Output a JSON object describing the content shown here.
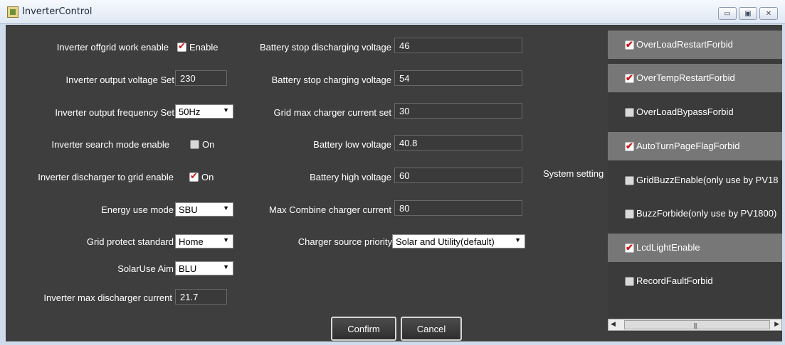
{
  "window": {
    "title": "InverterControl",
    "controls": [
      "▭",
      "▣",
      "✕"
    ]
  },
  "left": {
    "offgrid": {
      "label": "Inverter offgrid work enable",
      "checkbox_text": "Enable",
      "checked": true
    },
    "output_voltage": {
      "label": "Inverter output voltage Set",
      "value": "230"
    },
    "output_frequency": {
      "label": "Inverter output frequency Set",
      "value": "50Hz"
    },
    "search_mode": {
      "label": "Inverter search mode enable",
      "checkbox_text": "On",
      "checked": false
    },
    "discharger_grid": {
      "label": "Inverter discharger to grid enable",
      "checkbox_text": "On",
      "checked": true
    },
    "energy_mode": {
      "label": "Energy use mode",
      "value": "SBU"
    },
    "grid_standard": {
      "label": "Grid protect standard",
      "value": "Home"
    },
    "solar_aim": {
      "label": "SolarUse Aim",
      "value": "BLU"
    },
    "max_discharger": {
      "label": "Inverter max discharger current",
      "value": "21.7"
    }
  },
  "middle": {
    "stop_discharging": {
      "label": "Battery stop discharging voltage",
      "value": "46"
    },
    "stop_charging": {
      "label": "Battery stop charging voltage",
      "value": "54"
    },
    "grid_max_charger": {
      "label": "Grid max charger current set",
      "value": "30"
    },
    "battery_low": {
      "label": "Battery low voltage",
      "value": "40.8"
    },
    "battery_high": {
      "label": "Battery high voltage",
      "value": "60"
    },
    "max_combine": {
      "label": "Max Combine charger current",
      "value": "80"
    },
    "charger_priority": {
      "label": "Charger source priority",
      "value": "Solar and Utility(default)"
    }
  },
  "system_setting_label": "System setting",
  "system_settings": [
    {
      "label": "OverLoadRestartForbid",
      "checked": true
    },
    {
      "label": "OverTempRestartForbid",
      "checked": true
    },
    {
      "label": "OverLoadBypassForbid",
      "checked": false
    },
    {
      "label": "AutoTurnPageFlagForbid",
      "checked": true
    },
    {
      "label": "GridBuzzEnable(only use by PV18",
      "checked": false
    },
    {
      "label": "BuzzForbide(only use by PV1800)",
      "checked": false
    },
    {
      "label": "LcdLightEnable",
      "checked": true
    },
    {
      "label": "RecordFaultForbid",
      "checked": false
    }
  ],
  "buttons": {
    "confirm": "Confirm",
    "cancel": "Cancel"
  }
}
